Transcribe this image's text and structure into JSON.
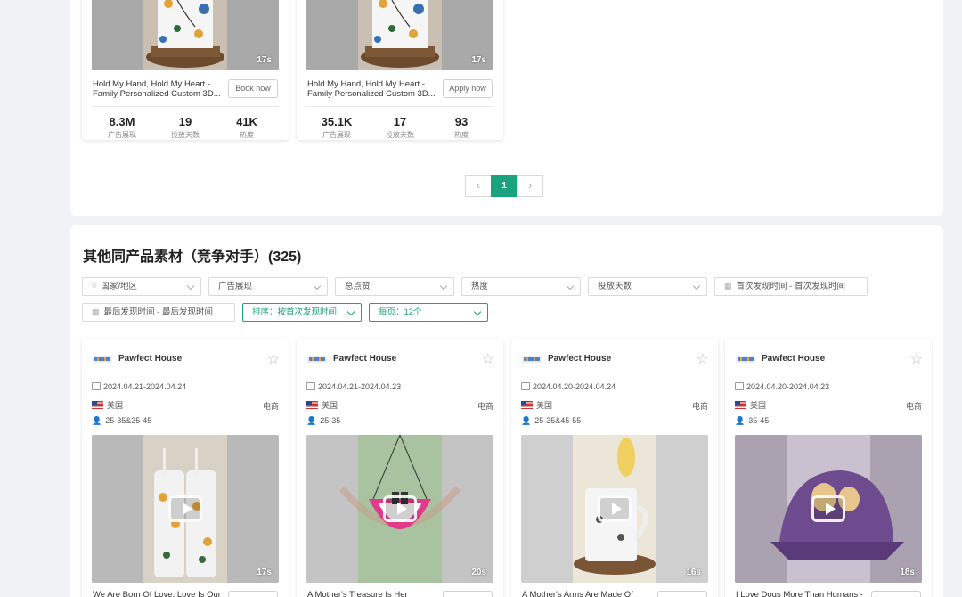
{
  "top_cards": [
    {
      "duration": "17s",
      "title": "Hold My Hand, Hold My Heart - Family Personalized Custom 3D...",
      "button": "Book now",
      "stats": [
        {
          "value": "8.3M",
          "label": "广告展现"
        },
        {
          "value": "19",
          "label": "投放天数"
        },
        {
          "value": "41K",
          "label": "热度"
        }
      ]
    },
    {
      "duration": "17s",
      "title": "Hold My Hand, Hold My Heart - Family Personalized Custom 3D...",
      "button": "Apply now",
      "stats": [
        {
          "value": "35.1K",
          "label": "广告展现"
        },
        {
          "value": "17",
          "label": "投放天数"
        },
        {
          "value": "93",
          "label": "热度"
        }
      ]
    }
  ],
  "pagination": {
    "prev": "‹",
    "current": "1",
    "next": "›"
  },
  "section": {
    "title": "其他同产品素材（竞争对手）(325)"
  },
  "filters": {
    "country": "国家/地区",
    "impressions": "广告展现",
    "likes": "总点赞",
    "heat": "热度",
    "days": "投放天数",
    "first_seen": "首次发现时间  -  首次发现时间",
    "last_seen": "最后发现时间  -  最后发现时间",
    "sort": "排序：按首次发现时间",
    "per_page": "每页：12个"
  },
  "cards": [
    {
      "brand": "Pawfect House",
      "date": "2024.04.21-2024.04.24",
      "country": "美国",
      "category": "电商",
      "age": "25-35&35-45",
      "duration": "17s",
      "title": "We Are Born Of Love, Love Is Our"
    },
    {
      "brand": "Pawfect House",
      "date": "2024.04.21-2024.04.23",
      "country": "美国",
      "category": "电商",
      "age": "25-35",
      "duration": "20s",
      "title": "A Mother's Treasure Is Her"
    },
    {
      "brand": "Pawfect House",
      "date": "2024.04.20-2024.04.24",
      "country": "美国",
      "category": "电商",
      "age": "25-35&45-55",
      "duration": "16s",
      "title": "A Mother's Arms Are Made Of"
    },
    {
      "brand": "Pawfect House",
      "date": "2024.04.20-2024.04.23",
      "country": "美国",
      "category": "电商",
      "age": "35-45",
      "duration": "18s",
      "title": "I Love Dogs More Than Humans -"
    }
  ],
  "colors": {
    "accent": "#1aa37c",
    "background": "#f0f2f5"
  },
  "icons": [
    "location-icon",
    "chevron-down-icon",
    "calendar-icon",
    "star-icon",
    "us-flag-icon",
    "person-icon",
    "play-icon"
  ]
}
